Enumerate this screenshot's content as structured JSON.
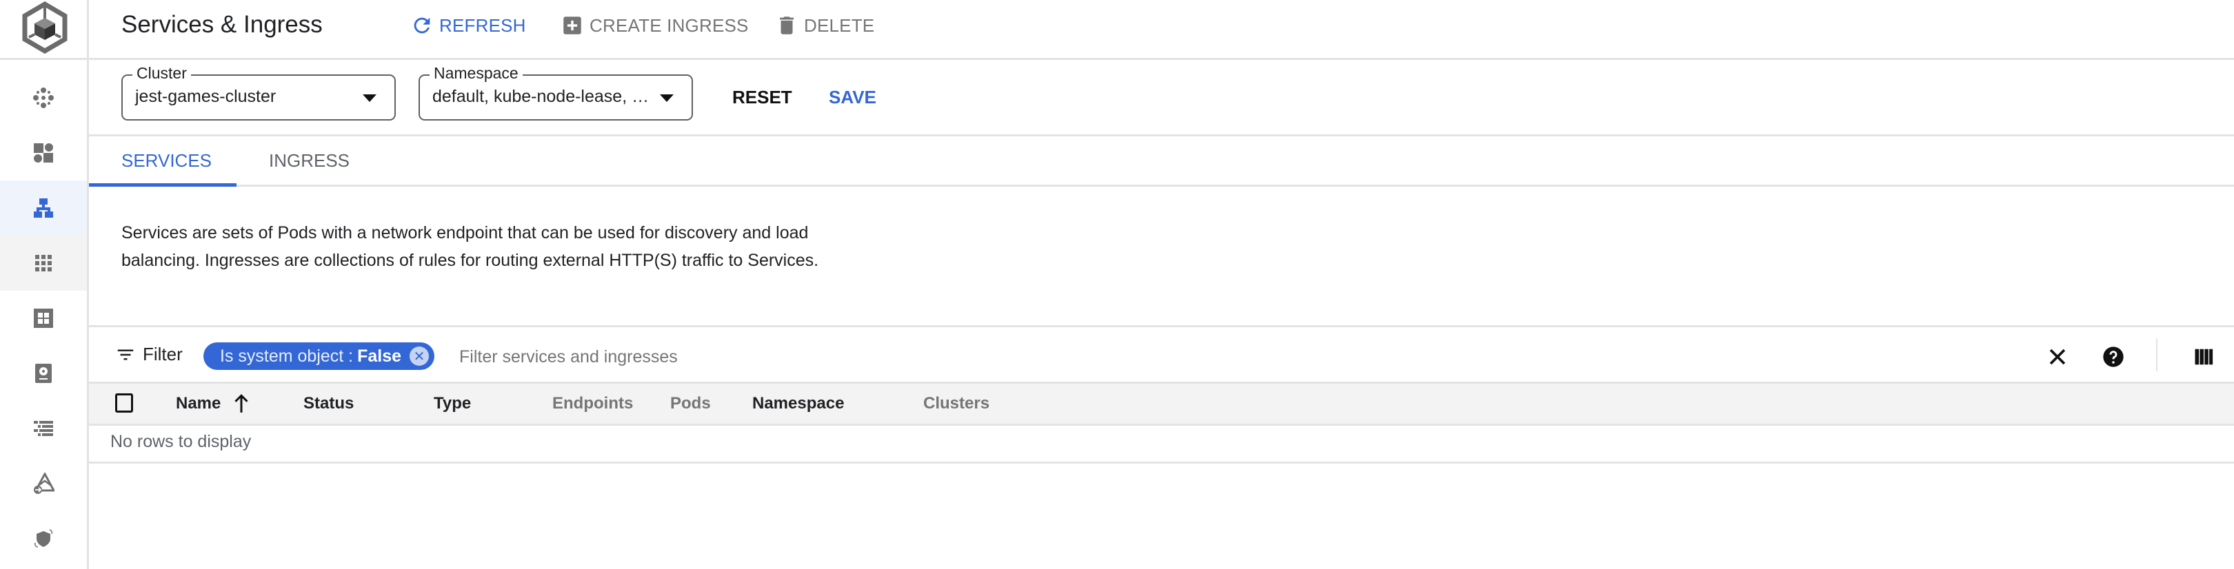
{
  "app": {
    "logo": "kubernetes-cube-logo"
  },
  "sidebar": {
    "items": [
      {
        "name": "clusters",
        "icon": "cluster-dots-icon",
        "active": false
      },
      {
        "name": "workloads",
        "icon": "workloads-icon",
        "active": false
      },
      {
        "name": "services-ingress",
        "icon": "network-tree-icon",
        "active": true
      },
      {
        "name": "applications",
        "icon": "apps-grid-icon",
        "active": false,
        "hover": true
      },
      {
        "name": "config",
        "icon": "config-grid-icon",
        "active": false
      },
      {
        "name": "storage",
        "icon": "storage-disk-icon",
        "active": false
      },
      {
        "name": "object-browser",
        "icon": "list-tree-icon",
        "active": false
      },
      {
        "name": "migrate",
        "icon": "migrate-icon",
        "active": false
      },
      {
        "name": "backup",
        "icon": "backup-shield-icon",
        "active": false
      }
    ]
  },
  "header": {
    "title": "Services & Ingress",
    "refresh_label": "REFRESH",
    "create_label": "CREATE INGRESS",
    "delete_label": "DELETE"
  },
  "selectors": {
    "cluster": {
      "label": "Cluster",
      "value": "jest-games-cluster"
    },
    "namespace": {
      "label": "Namespace",
      "value": "default, kube-node-lease, …"
    },
    "reset_label": "RESET",
    "save_label": "SAVE"
  },
  "tabs": [
    {
      "label": "SERVICES",
      "active": true
    },
    {
      "label": "INGRESS",
      "active": false
    }
  ],
  "description": "Services are sets of Pods with a network endpoint that can be used for discovery and load balancing. Ingresses are collections of rules for routing external HTTP(S) traffic to Services.",
  "filter": {
    "label": "Filter",
    "chip_key": "Is system object :",
    "chip_value": "False",
    "placeholder": "Filter services and ingresses",
    "value": ""
  },
  "table": {
    "columns": [
      {
        "label": "Name",
        "sorted": "ascending",
        "style": "dark"
      },
      {
        "label": "Status",
        "style": "dark"
      },
      {
        "label": "Type",
        "style": "dark"
      },
      {
        "label": "Endpoints",
        "style": "muted"
      },
      {
        "label": "Pods",
        "style": "muted"
      },
      {
        "label": "Namespace",
        "style": "dark"
      },
      {
        "label": "Clusters",
        "style": "muted"
      }
    ],
    "empty_message": "No rows to display"
  },
  "colors": {
    "accent": "#3367d6",
    "active_nav_bg": "#eef3fc",
    "header_bg": "#f3f3f3",
    "border": "#e3e3e3",
    "muted_text": "#757575"
  }
}
